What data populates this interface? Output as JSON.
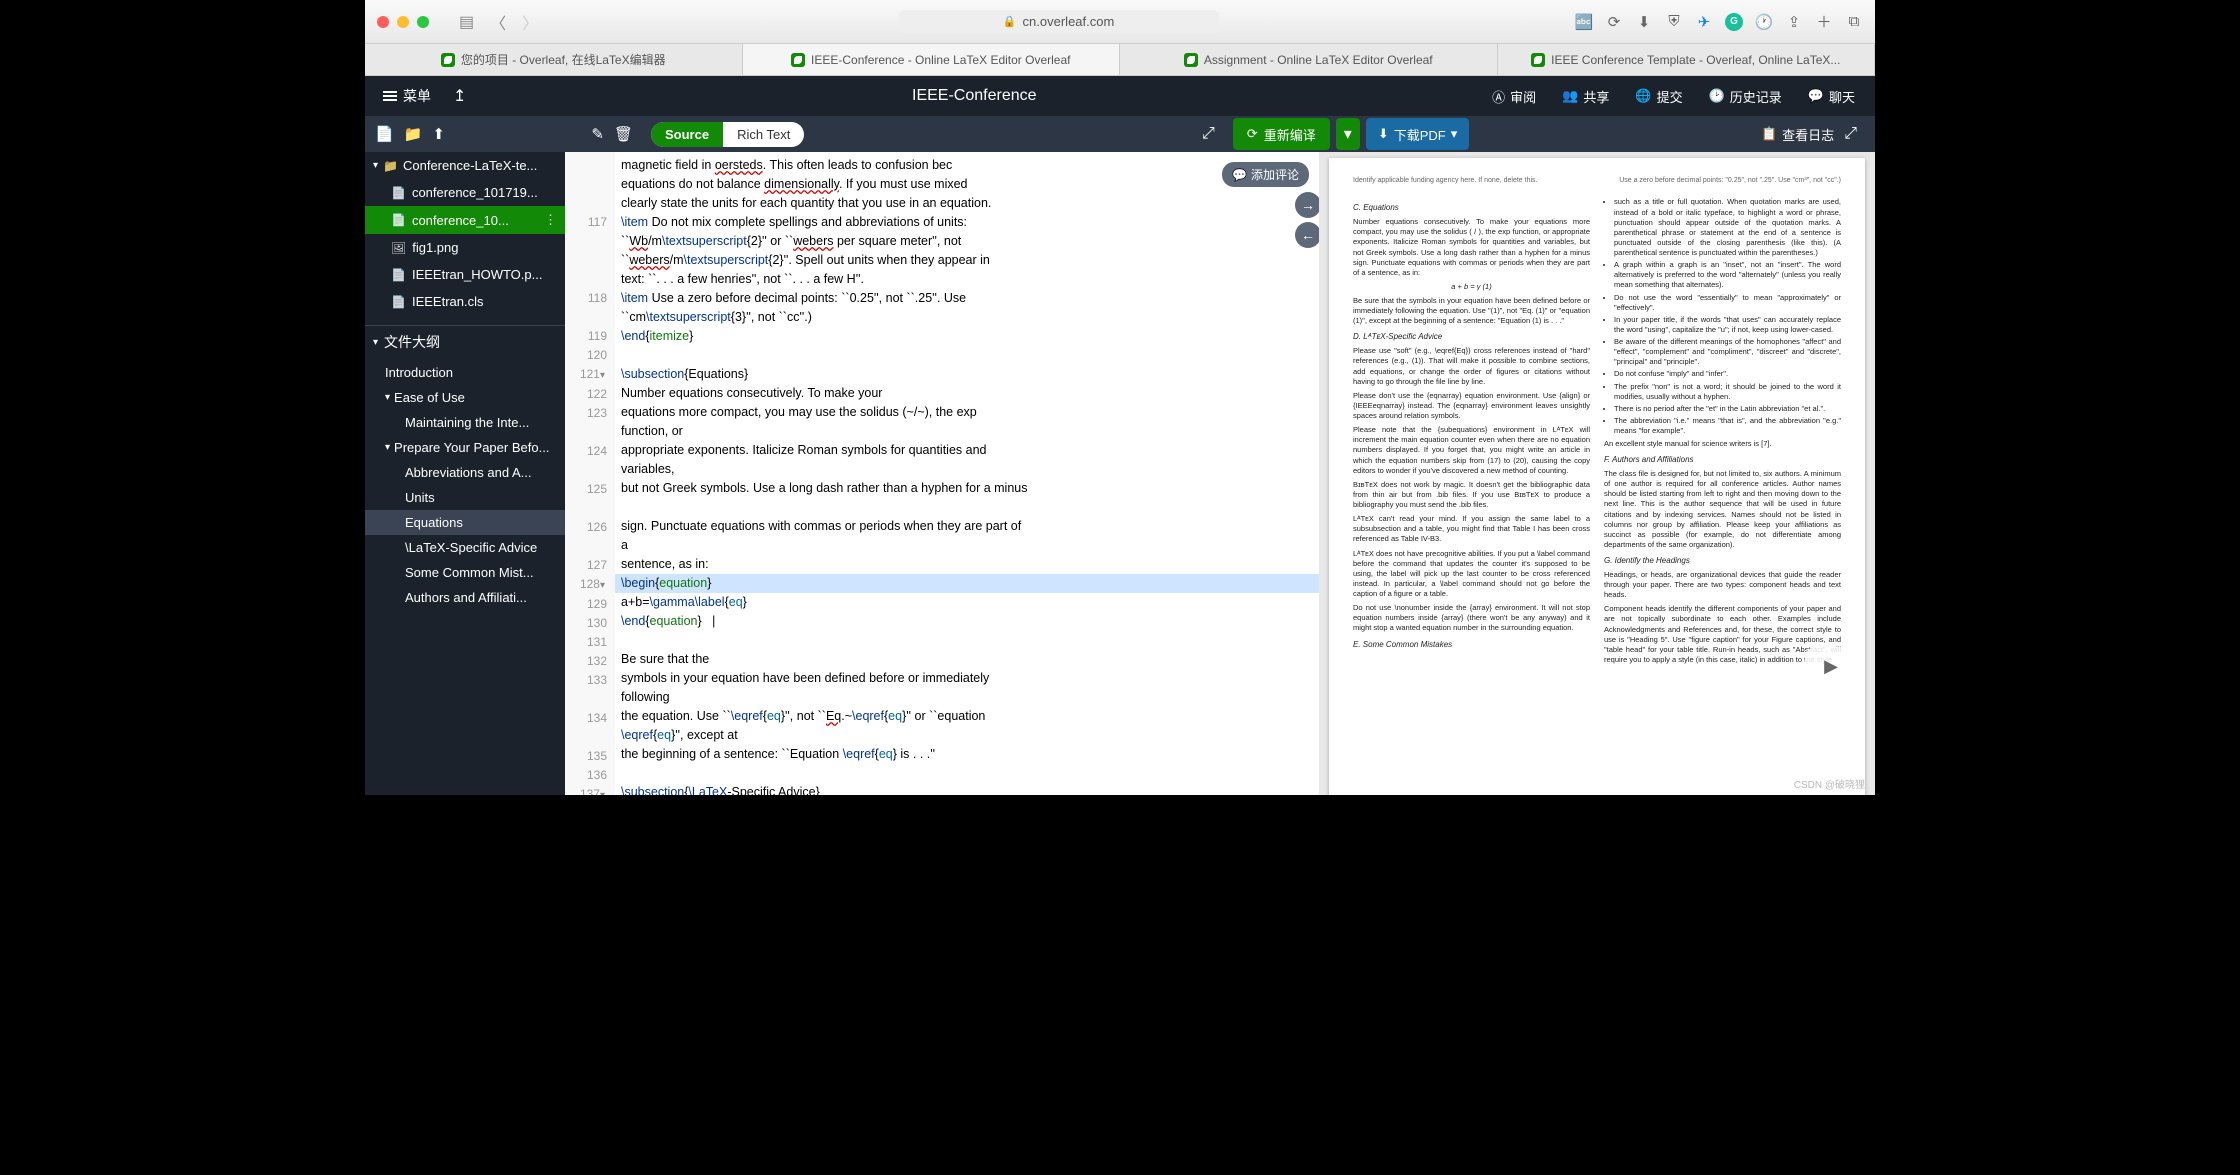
{
  "browser": {
    "url": "cn.overleaf.com",
    "tabs": [
      "您的项目 - Overleaf, 在线LaTeX编辑器",
      "IEEE-Conference - Online LaTeX Editor Overleaf",
      "Assignment - Online LaTeX Editor Overleaf",
      "IEEE Conference Template - Overleaf, Online LaTeX..."
    ]
  },
  "header": {
    "menu": "菜单",
    "title": "IEEE-Conference",
    "review": "审阅",
    "share": "共享",
    "submit": "提交",
    "history": "历史记录",
    "chat": "聊天"
  },
  "toolbar": {
    "source": "Source",
    "richtext": "Rich Text",
    "recompile": "重新编译",
    "download": "下载PDF",
    "logs": "查看日志",
    "add_comment": "添加评论"
  },
  "filetree": {
    "folder": "Conference-LaTeX-te...",
    "files": [
      "conference_101719...",
      "conference_10...",
      "fig1.png",
      "IEEEtran_HOWTO.p...",
      "IEEEtran.cls"
    ]
  },
  "outline": {
    "header": "文件大纲",
    "items": [
      {
        "label": "Introduction",
        "level": 1
      },
      {
        "label": "Ease of Use",
        "level": 1,
        "caret": true
      },
      {
        "label": "Maintaining the Inte...",
        "level": 2
      },
      {
        "label": "Prepare Your Paper Befo...",
        "level": 1,
        "caret": true
      },
      {
        "label": "Abbreviations and A...",
        "level": 2
      },
      {
        "label": "Units",
        "level": 2
      },
      {
        "label": "Equations",
        "level": 2,
        "active": true
      },
      {
        "label": "\\LaTeX-Specific Advice",
        "level": 2
      },
      {
        "label": "Some Common Mist...",
        "level": 2
      },
      {
        "label": "Authors and Affiliati...",
        "level": 2
      }
    ]
  },
  "editor": {
    "lines": [
      {
        "n": "",
        "t": "magnetic field in <err>oersteds</err>. This often leads to confusion bec<cut>",
        "wrap": true
      },
      {
        "n": "",
        "t": "equations do not balance <err>dimensionally</err>. If you must use mixed <cut>",
        "wrap": true
      },
      {
        "n": "",
        "t": "clearly state the units for each quantity that you use in an equation.",
        "wrap": true
      },
      {
        "n": "117",
        "t": "<cmd>\\item</cmd> Do not mix complete spellings and abbreviations of units:"
      },
      {
        "n": "",
        "t": "``<err>Wb</err>/m<cmd>\\textsuperscript</cmd>{2}'' or ``<err>webers</err> per square meter'', not",
        "wrap": true
      },
      {
        "n": "",
        "t": "``<err>webers</err>/m<cmd>\\textsuperscript</cmd>{2}''. Spell out units when they appear in",
        "wrap": true
      },
      {
        "n": "",
        "t": "text: ``. . . a few henries'', not ``. . . a few H''.",
        "wrap": true
      },
      {
        "n": "118",
        "t": "<cmd>\\item</cmd> Use a zero before decimal points: ``0.25'', not ``.25''. Use"
      },
      {
        "n": "",
        "t": "``cm<cmd>\\textsuperscript</cmd>{3}'', not ``cc''.)",
        "wrap": true
      },
      {
        "n": "119",
        "t": "<cmd>\\end</cmd>{<env>itemize</env>}"
      },
      {
        "n": "120",
        "t": ""
      },
      {
        "n": "121",
        "t": "<cmd>\\subsection</cmd>{Equations}",
        "fold": true
      },
      {
        "n": "122",
        "t": "Number equations consecutively. To make your"
      },
      {
        "n": "123",
        "t": "equations more compact, you may use the solidus (~/~), the exp"
      },
      {
        "n": "",
        "t": "function, or",
        "wrap": true
      },
      {
        "n": "124",
        "t": "appropriate exponents. Italicize Roman symbols for quantities and"
      },
      {
        "n": "",
        "t": "variables,",
        "wrap": true
      },
      {
        "n": "125",
        "t": "but not Greek symbols. Use a long dash rather than a hyphen for a minus"
      },
      {
        "n": "",
        "t": "",
        "wrap": true
      },
      {
        "n": "126",
        "t": "sign. Punctuate equations with commas or periods when they are part of"
      },
      {
        "n": "",
        "t": "a",
        "wrap": true
      },
      {
        "n": "127",
        "t": "sentence, as in:"
      },
      {
        "n": "128",
        "t": "<cmd>\\begin</cmd>{<env>equation</env>}",
        "hl": true,
        "fold": true
      },
      {
        "n": "129",
        "t": "a+b=<cmd>\\gamma\\label</cmd>{<arg>eq</arg>}"
      },
      {
        "n": "130",
        "t": "<cmd>\\end</cmd>{<env>equation</env>}   |"
      },
      {
        "n": "131",
        "t": ""
      },
      {
        "n": "132",
        "t": "Be sure that the"
      },
      {
        "n": "133",
        "t": "symbols in your equation have been defined before or immediately"
      },
      {
        "n": "",
        "t": "following",
        "wrap": true
      },
      {
        "n": "134",
        "t": "the equation. Use ``<cmd>\\eqref</cmd>{<arg>eq</arg>}'', not ``<err>Eq</err>.~<cmd>\\eqref</cmd>{<arg>eq</arg>}'' or ``equation"
      },
      {
        "n": "",
        "t": "<cmd>\\eqref</cmd>{<arg>eq</arg>}'', except at",
        "wrap": true
      },
      {
        "n": "135",
        "t": "the beginning of a sentence: ``Equation <cmd>\\eqref</cmd>{<arg>eq</arg>} is . . .''"
      },
      {
        "n": "136",
        "t": ""
      },
      {
        "n": "137",
        "t": "<cmd>\\subsection</cmd>{<cmd>\\LaTeX</cmd>-Specific Advice}",
        "fold": true
      }
    ]
  },
  "pdf": {
    "top_left": "Identify applicable funding agency here. If none, delete this.",
    "top_right": "Use a zero before decimal points: \"0.25\", not \".25\". Use \"cm³\", not \"cc\".)",
    "sec_c": "C. Equations",
    "c1": "Number equations consecutively. To make your equations more compact, you may use the solidus ( / ), the exp function, or appropriate exponents. Italicize Roman symbols for quantities and variables, but not Greek symbols. Use a long dash rather than a hyphen for a minus sign. Punctuate equations with commas or periods when they are part of a sentence, as in:",
    "eq": "a + b = γ        (1)",
    "c2": "Be sure that the symbols in your equation have been defined before or immediately following the equation. Use \"(1)\", not \"Eq. (1)\" or \"equation (1)\", except at the beginning of a sentence: \"Equation (1) is . . .\"",
    "sec_d": "D. LᴬTᴇX-Specific Advice",
    "d1": "Please use \"soft\" (e.g., \\eqref{Eq}) cross references instead of \"hard\" references (e.g., (1)). That will make it possible to combine sections, add equations, or change the order of figures or citations without having to go through the file line by line.",
    "d2": "Please don't use the {eqnarray} equation environment. Use {align} or {IEEEeqnarray} instead. The {eqnarray} environment leaves unsightly spaces around relation symbols.",
    "d3": "Please note that the {subequations} environment in LᴬTᴇX will increment the main equation counter even when there are no equation numbers displayed. If you forget that, you might write an article in which the equation numbers skip from (17) to (20), causing the copy editors to wonder if you've discovered a new method of counting.",
    "d4": "BɪʙTᴇX does not work by magic. It doesn't get the bibliographic data from thin air but from .bib files. If you use BɪʙTᴇX to produce a bibliography you must send the .bib files.",
    "d5": "LᴬTᴇX can't read your mind. If you assign the same label to a subsubsection and a table, you might find that Table I has been cross referenced as Table IV-B3.",
    "d6": "LᴬTᴇX does not have precognitive abilities. If you put a \\label command before the command that updates the counter it's supposed to be using, the label will pick up the last counter to be cross referenced instead. In particular, a \\label command should not go before the caption of a figure or a table.",
    "d7": "Do not use \\nonumber inside the {array} environment. It will not stop equation numbers inside {array} (there won't be any anyway) and it might stop a wanted equation number in the surrounding equation.",
    "sec_e": "E. Some Common Mistakes",
    "e_items": [
      "such as a title or full quotation. When quotation marks are used, instead of a bold or italic typeface, to highlight a word or phrase, punctuation should appear outside of the quotation marks. A parenthetical phrase or statement at the end of a sentence is punctuated outside of the closing parenthesis (like this). (A parenthetical sentence is punctuated within the parentheses.)",
      "A graph within a graph is an \"inset\", not an \"insert\". The word alternatively is preferred to the word \"alternately\" (unless you really mean something that alternates).",
      "Do not use the word \"essentially\" to mean \"approximately\" or \"effectively\".",
      "In your paper title, if the words \"that uses\" can accurately replace the word \"using\", capitalize the \"u\"; if not, keep using lower-cased.",
      "Be aware of the different meanings of the homophones \"affect\" and \"effect\", \"complement\" and \"compliment\", \"discreet\" and \"discrete\", \"principal\" and \"principle\".",
      "Do not confuse \"imply\" and \"infer\".",
      "The prefix \"non\" is not a word; it should be joined to the word it modifies, usually without a hyphen.",
      "There is no period after the \"et\" in the Latin abbreviation \"et al.\".",
      "The abbreviation \"i.e.\" means \"that is\", and the abbreviation \"e.g.\" means \"for example\"."
    ],
    "e_tail": "An excellent style manual for science writers is [7].",
    "sec_f": "F. Authors and Affiliations",
    "f1": "The class file is designed for, but not limited to, six authors. A minimum of one author is required for all conference articles. Author names should be listed starting from left to right and then moving down to the next line. This is the author sequence that will be used in future citations and by indexing services. Names should not be listed in columns nor group by affiliation. Please keep your affiliations as succinct as possible (for example, do not differentiate among departments of the same organization).",
    "sec_g": "G. Identify the Headings",
    "g1": "Headings, or heads, are organizational devices that guide the reader through your paper. There are two types: component heads and text heads.",
    "g2": "Component heads identify the different components of your paper and are not topically subordinate to each other. Examples include Acknowledgments and References and, for these, the correct style to use is \"Heading 5\". Use \"figure caption\" for your Figure captions, and \"table head\" for your table title. Run-in heads, such as \"Abstract\", will require you to apply a style (in this case, italic) in addition to the style"
  },
  "watermark": "CSDN @破晓狸"
}
